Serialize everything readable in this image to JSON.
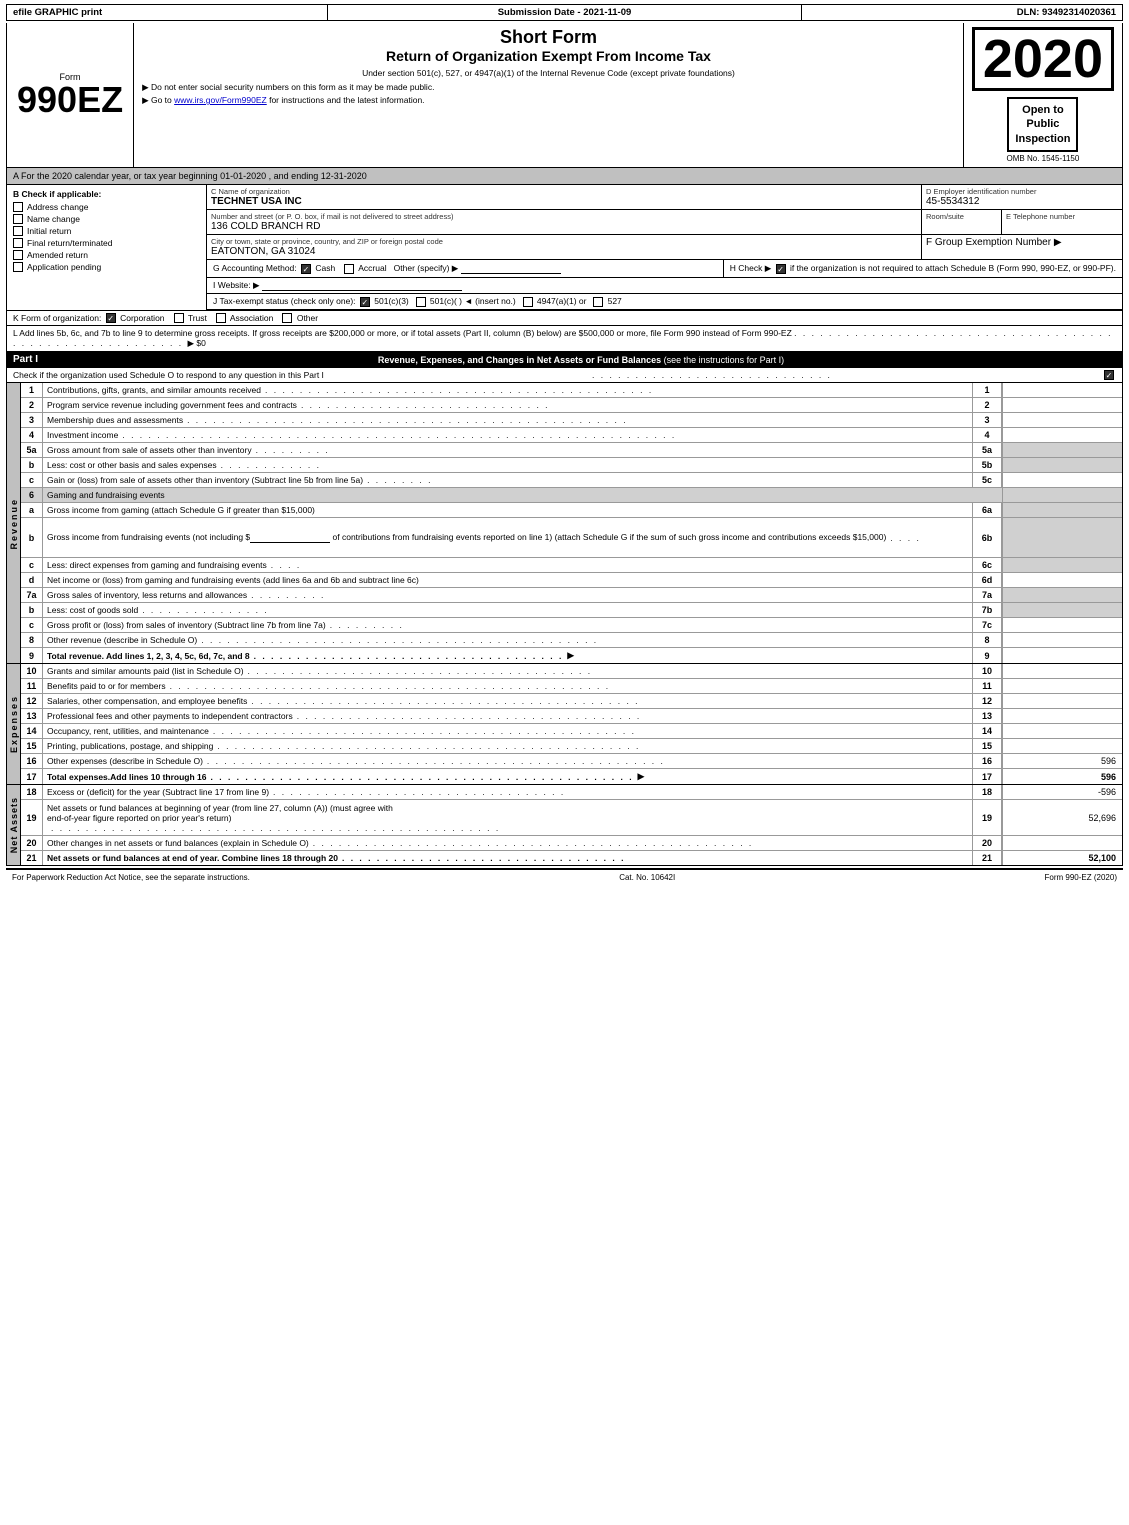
{
  "topBar": {
    "left": "efile GRAPHIC print",
    "middle": "Submission Date - 2021-11-09",
    "right": "DLN: 93492314020361"
  },
  "formLabel": "Form",
  "form990ez": "990EZ",
  "formSubLabel": "",
  "mainTitle": "Short Form",
  "returnTitle": "Return of Organization Exempt From Income Tax",
  "subtitle": "Under section 501(c), 527, or 4947(a)(1) of the Internal Revenue Code (except private foundations)",
  "notice1": "▶ Do not enter social security numbers on this form as it may be made public.",
  "notice2": "▶ Go to www.irs.gov/Form990EZ for instructions and the latest information.",
  "year": "2020",
  "ombNo": "OMB No. 1545-1150",
  "openToPublic": "Open to\nPublic\nInspection",
  "calendarLine": "A For the 2020 calendar year, or tax year beginning 01-01-2020 , and ending 12-31-2020",
  "checkApplicable": {
    "label": "B Check if applicable:",
    "items": [
      {
        "id": "address-change",
        "label": "Address change",
        "checked": false
      },
      {
        "id": "name-change",
        "label": "Name change",
        "checked": false
      },
      {
        "id": "initial-return",
        "label": "Initial return",
        "checked": false
      },
      {
        "id": "final-return",
        "label": "Final return/terminated",
        "checked": false
      },
      {
        "id": "amended-return",
        "label": "Amended return",
        "checked": false
      },
      {
        "id": "application-pending",
        "label": "Application pending",
        "checked": false
      }
    ]
  },
  "orgName": {
    "label": "C Name of organization",
    "value": "TECHNET USA INC"
  },
  "employerID": {
    "label": "D Employer identification number",
    "value": "45-5534312"
  },
  "address": {
    "label": "Number and street (or P. O. box, if mail is not delivered to street address)",
    "value": "136 COLD BRANCH RD",
    "roomLabel": "Room/suite",
    "roomValue": ""
  },
  "telephone": {
    "label": "E Telephone number",
    "value": ""
  },
  "cityState": {
    "label": "City or town, state or province, country, and ZIP or foreign postal code",
    "value": "EATONTON, GA  31024"
  },
  "groupExemption": {
    "label": "F Group Exemption Number ▶",
    "value": ""
  },
  "accounting": {
    "label": "G Accounting Method:",
    "cash": "Cash",
    "accrual": "Accrual",
    "other": "Other (specify) ▶",
    "cashChecked": true,
    "accrualChecked": false
  },
  "hCheck": {
    "text": "H Check ▶",
    "subtext": "if the organization is not required to attach Schedule B (Form 990, 990-EZ, or 990-PF).",
    "checked": true
  },
  "website": {
    "label": "I Website: ▶",
    "value": ""
  },
  "taxExempt": {
    "label": "J Tax-exempt status (check only one):",
    "options": [
      {
        "label": "501(c)(3)",
        "checked": true
      },
      {
        "label": "501(c)(  ) ◄ (insert no.)",
        "checked": false
      },
      {
        "label": "4947(a)(1) or",
        "checked": false
      },
      {
        "label": "527",
        "checked": false
      }
    ]
  },
  "formOrg": {
    "label": "K Form of organization:",
    "options": [
      {
        "label": "Corporation",
        "checked": true
      },
      {
        "label": "Trust",
        "checked": false
      },
      {
        "label": "Association",
        "checked": false
      },
      {
        "label": "Other",
        "checked": false
      }
    ]
  },
  "addLines": "L Add lines 5b, 6c, and 7b to line 9 to determine gross receipts. If gross receipts are $200,000 or more, or if total assets (Part II, column (B) below) are $500,000 or more, file Form 990 instead of Form 990-EZ",
  "addLinesAmount": "▶ $0",
  "partI": {
    "header": "Part I",
    "title": "Revenue, Expenses, and Changes in Net Assets or Fund Balances",
    "subtitle": "(see the instructions for Part I)",
    "checkLine": "Check if the organization used Schedule O to respond to any question in this Part I",
    "rows": [
      {
        "num": "1",
        "desc": "Contributions, gifts, grants, and similar amounts received",
        "dots": true,
        "amount": ""
      },
      {
        "num": "2",
        "desc": "Program service revenue including government fees and contracts",
        "dots": true,
        "amount": ""
      },
      {
        "num": "3",
        "desc": "Membership dues and assessments",
        "dots": true,
        "amount": ""
      },
      {
        "num": "4",
        "desc": "Investment income",
        "dots": true,
        "amount": ""
      },
      {
        "num": "5a",
        "desc": "Gross amount from sale of assets other than inventory",
        "subBox": "5a",
        "amount": ""
      },
      {
        "num": "b",
        "desc": "Less: cost or other basis and sales expenses",
        "subBox": "5b",
        "amount": ""
      },
      {
        "num": "c",
        "desc": "Gain or (loss) from sale of assets other than inventory (Subtract line 5b from line 5a)",
        "dots": true,
        "boxNum": "5c",
        "amount": ""
      },
      {
        "num": "6",
        "desc": "Gaming and fundraising events",
        "shaded": true
      },
      {
        "num": "a",
        "desc": "Gross income from gaming (attach Schedule G if greater than $15,000)",
        "subBox": "6a",
        "amount": ""
      },
      {
        "num": "b",
        "desc": "Gross income from fundraising events (not including $_____ of contributions from fundraising events reported on line 1) (attach Schedule G if the sum of such gross income and contributions exceeds $15,000)",
        "subBox": "6b",
        "amount": ""
      },
      {
        "num": "c",
        "desc": "Less: direct expenses from gaming and fundraising events",
        "subBox": "6c",
        "amount": ""
      },
      {
        "num": "d",
        "desc": "Net income or (loss) from gaming and fundraising events (add lines 6a and 6b and subtract line 6c)",
        "boxNum": "6d",
        "amount": ""
      },
      {
        "num": "7a",
        "desc": "Gross sales of inventory, less returns and allowances",
        "subBox": "7a",
        "amount": ""
      },
      {
        "num": "b",
        "desc": "Less: cost of goods sold",
        "subBox": "7b",
        "amount": ""
      },
      {
        "num": "c",
        "desc": "Gross profit or (loss) from sales of inventory (Subtract line 7b from line 7a)",
        "dots": true,
        "boxNum": "7c",
        "amount": ""
      },
      {
        "num": "8",
        "desc": "Other revenue (describe in Schedule O)",
        "dots": true,
        "boxNum": "8",
        "amount": ""
      },
      {
        "num": "9",
        "desc": "Total revenue. Add lines 1, 2, 3, 4, 5c, 6d, 7c, and 8",
        "dots": true,
        "arrow": true,
        "boxNum": "9",
        "amount": "",
        "bold": true
      }
    ]
  },
  "expenses": {
    "rows": [
      {
        "num": "10",
        "desc": "Grants and similar amounts paid (list in Schedule O)",
        "dots": true,
        "boxNum": "10",
        "amount": ""
      },
      {
        "num": "11",
        "desc": "Benefits paid to or for members",
        "dots": true,
        "boxNum": "11",
        "amount": ""
      },
      {
        "num": "12",
        "desc": "Salaries, other compensation, and employee benefits",
        "dots": true,
        "boxNum": "12",
        "amount": ""
      },
      {
        "num": "13",
        "desc": "Professional fees and other payments to independent contractors",
        "dots": true,
        "boxNum": "13",
        "amount": ""
      },
      {
        "num": "14",
        "desc": "Occupancy, rent, utilities, and maintenance",
        "dots": true,
        "boxNum": "14",
        "amount": ""
      },
      {
        "num": "15",
        "desc": "Printing, publications, postage, and shipping",
        "dots": true,
        "boxNum": "15",
        "amount": ""
      },
      {
        "num": "16",
        "desc": "Other expenses (describe in Schedule O)",
        "dots": true,
        "boxNum": "16",
        "amount": "596"
      },
      {
        "num": "17",
        "desc": "Total expenses. Add lines 10 through 16",
        "dots": true,
        "arrow": true,
        "boxNum": "17",
        "amount": "596",
        "bold": true
      }
    ]
  },
  "netAssets": {
    "rows": [
      {
        "num": "18",
        "desc": "Excess or (deficit) for the year (Subtract line 17 from line 9)",
        "dots": true,
        "boxNum": "18",
        "amount": "-596"
      },
      {
        "num": "19",
        "desc": "Net assets or fund balances at beginning of year (from line 27, column (A)) (must agree with end-of-year figure reported on prior year's return)",
        "dots": true,
        "boxNum": "19",
        "amount": "52,696"
      },
      {
        "num": "20",
        "desc": "Other changes in net assets or fund balances (explain in Schedule O)",
        "dots": true,
        "boxNum": "20",
        "amount": ""
      },
      {
        "num": "21",
        "desc": "Net assets or fund balances at end of year. Combine lines 18 through 20",
        "dots": true,
        "boxNum": "21",
        "amount": "52,100",
        "bold": true
      }
    ]
  },
  "footer": {
    "left": "For Paperwork Reduction Act Notice, see the separate instructions.",
    "middle": "Cat. No. 10642I",
    "right": "Form 990-EZ (2020)"
  }
}
